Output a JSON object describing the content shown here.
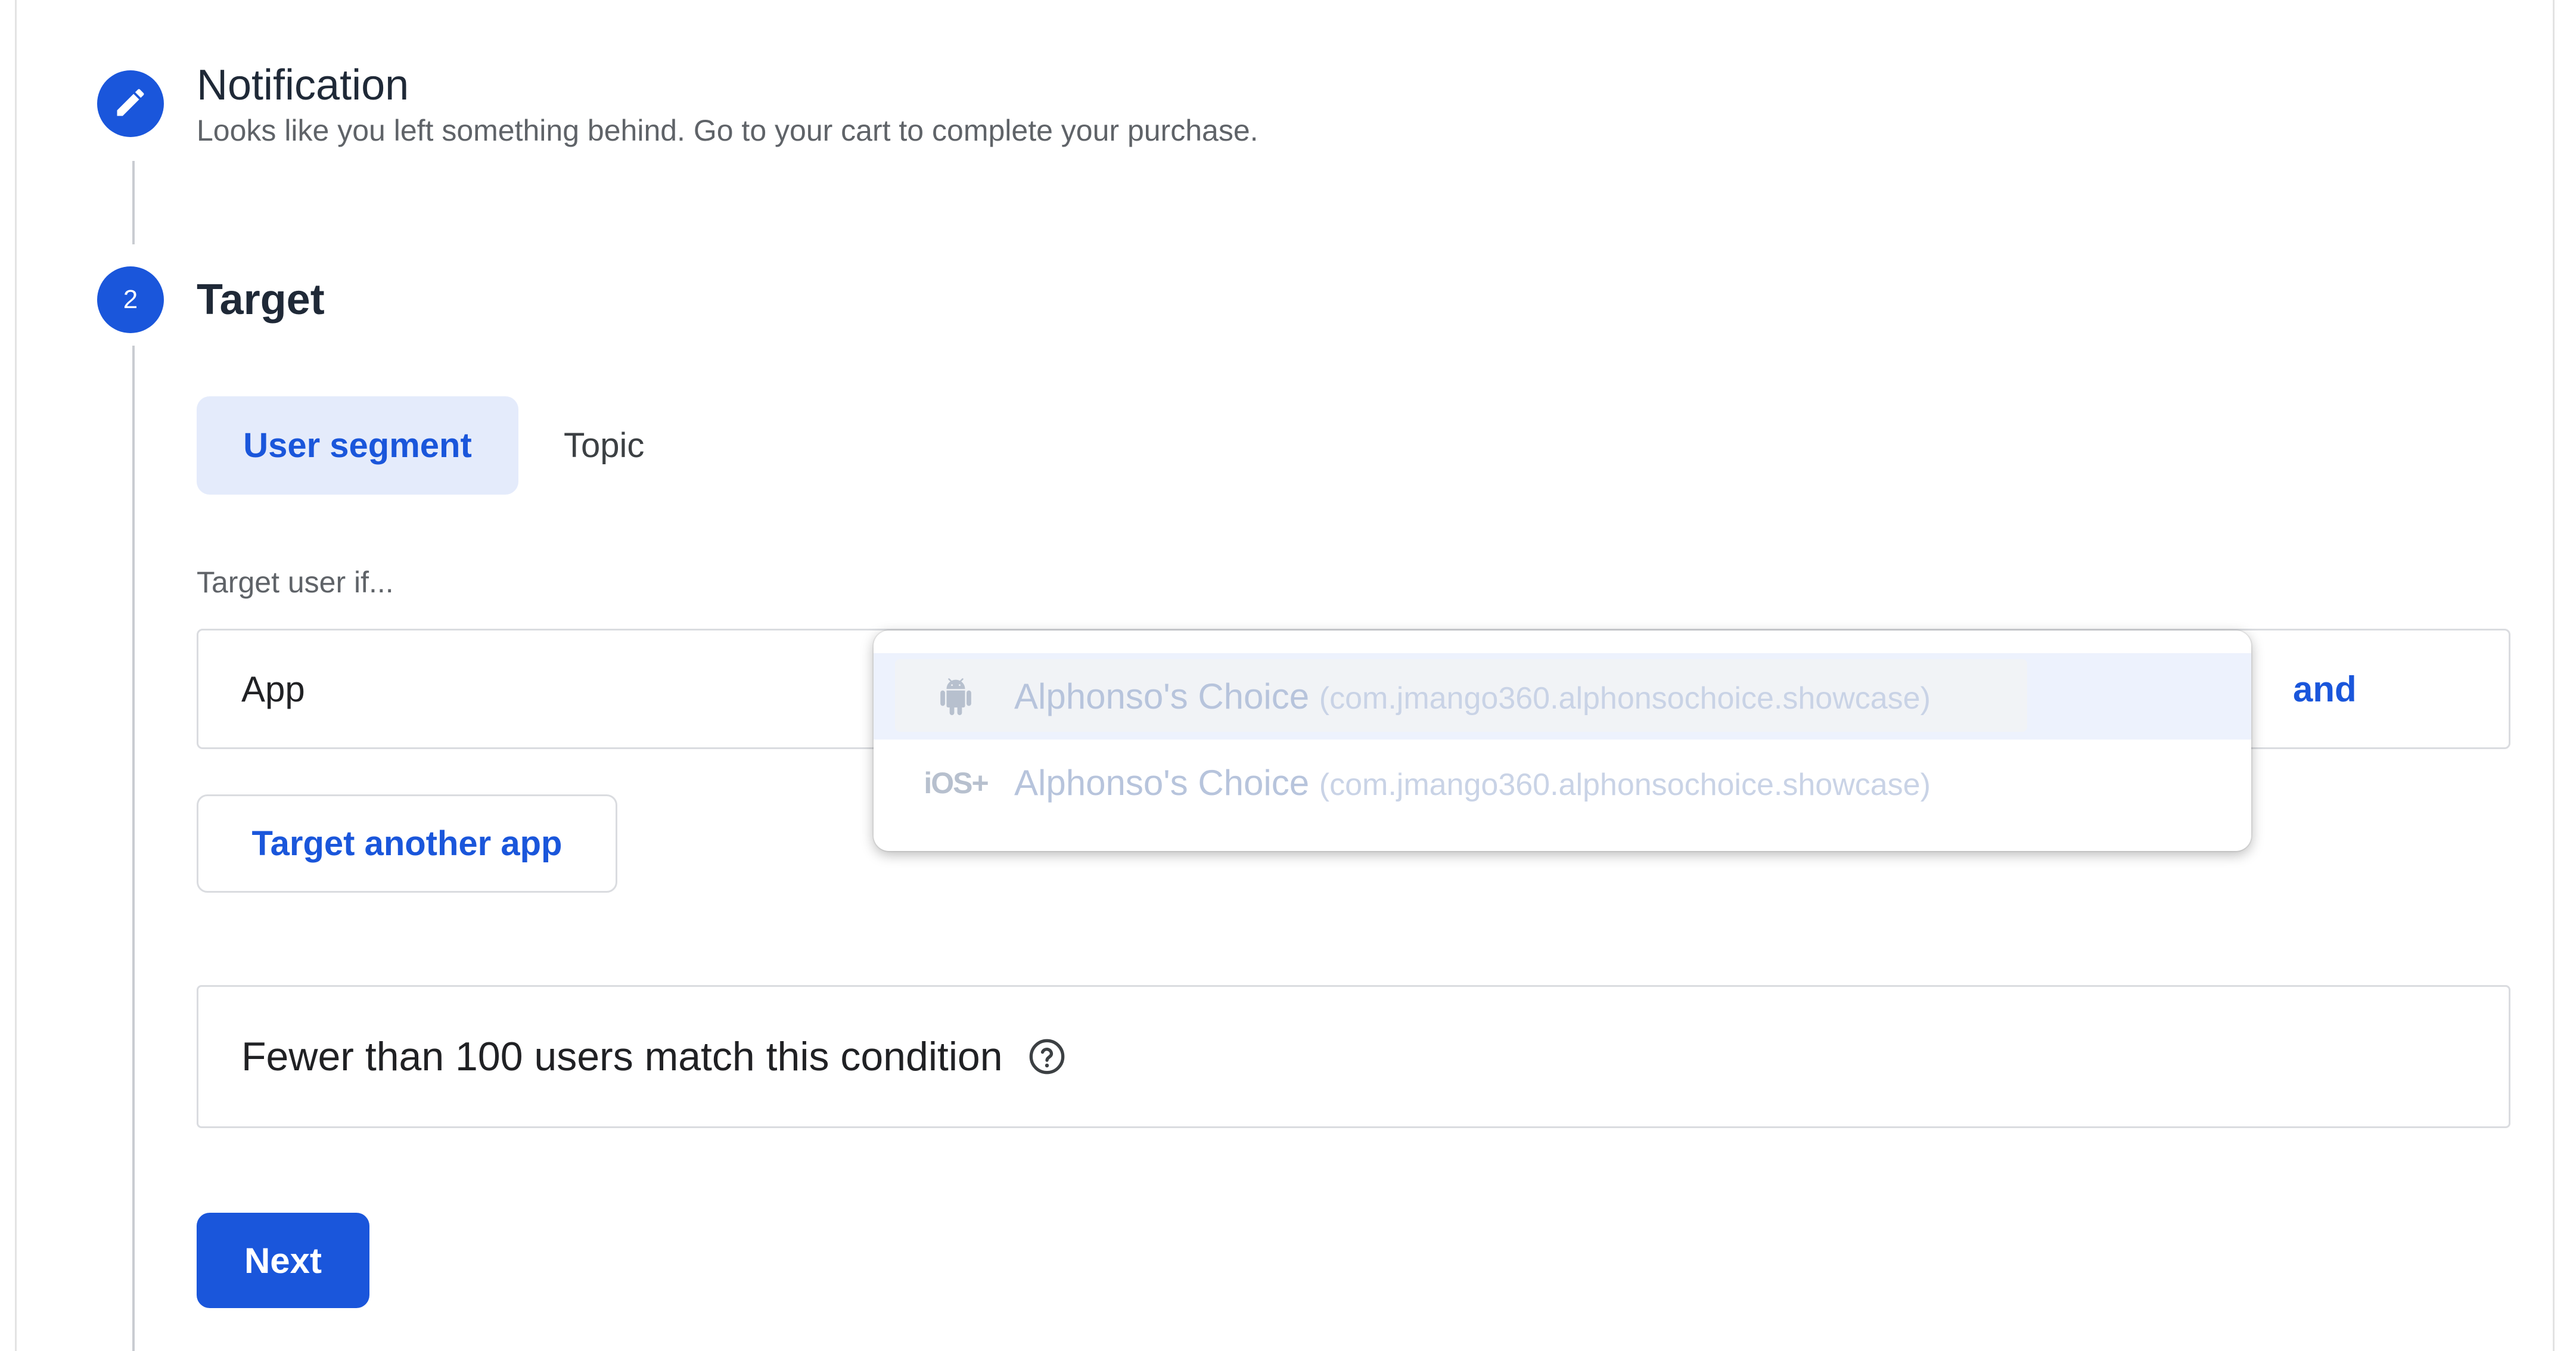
{
  "steps": [
    {
      "number": "",
      "icon": "pencil-icon",
      "title": "Notification",
      "subtitle": "Looks like you left something behind. Go to your cart to complete your purchase."
    },
    {
      "number": "2",
      "title": "Target"
    }
  ],
  "target": {
    "tabs": [
      {
        "label": "User segment",
        "active": true
      },
      {
        "label": "Topic",
        "active": false
      }
    ],
    "condition_label": "Target user if...",
    "condition": {
      "field": "App",
      "conjunction": "and"
    },
    "app_options": [
      {
        "platform_icon": "android-icon",
        "name": "Alphonso's Choice",
        "package": "(com.jmango360.alphonsochoice.showcase)",
        "highlighted": true
      },
      {
        "platform_icon": "ios-icon",
        "platform_label": "iOS+",
        "name": "Alphonso's Choice",
        "package": "(com.jmango360.alphonsochoice.showcase)",
        "highlighted": false
      }
    ],
    "add_app_label": "Target another app",
    "match_info": "Fewer than 100 users match this condition",
    "next_label": "Next"
  },
  "colors": {
    "accent": "#1a56db",
    "tab_active_bg": "#e4ebfb",
    "border": "#dadce0",
    "muted_text": "#5f6368"
  }
}
